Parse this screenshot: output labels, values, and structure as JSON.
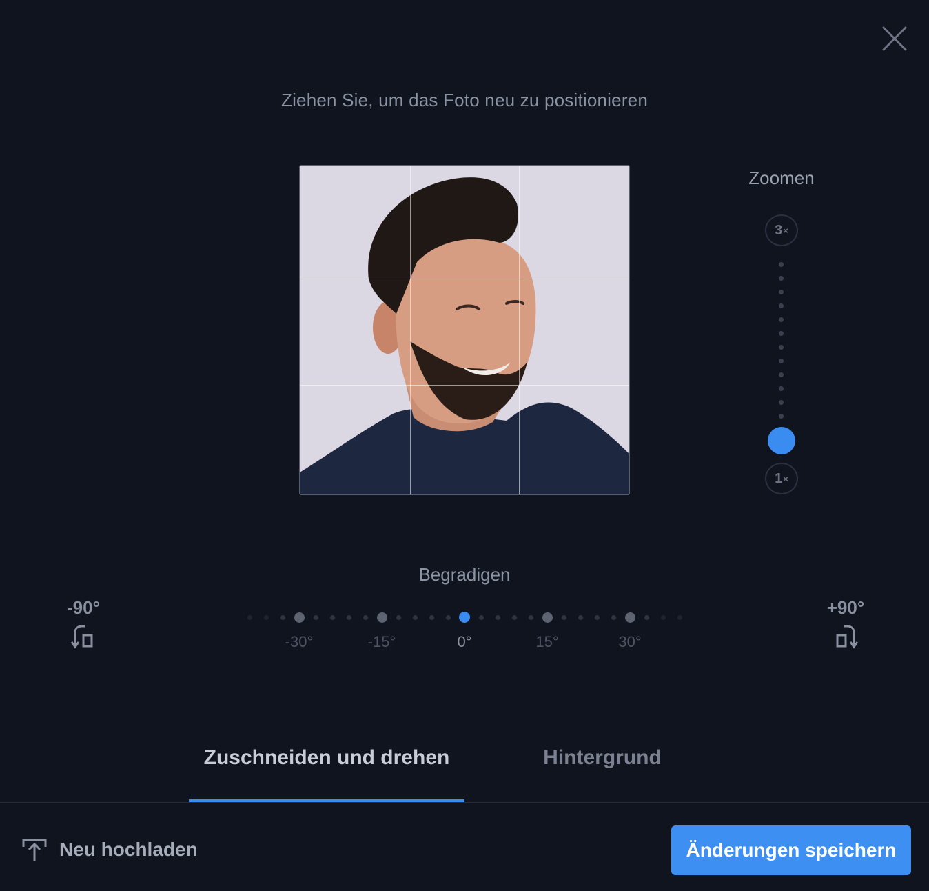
{
  "colors": {
    "background": "#10141f",
    "accent": "#3b8cf0",
    "text_primary": "#c7ccd6",
    "text_muted": "#8c93a3"
  },
  "dialog": {
    "close_icon": "close-icon",
    "instruction": "Ziehen Sie, um das Foto neu zu positionieren"
  },
  "zoom": {
    "label": "Zoomen",
    "max_label": "3",
    "min_label": "1",
    "unit": "×",
    "current_fraction": 0
  },
  "straighten": {
    "label": "Begradigen",
    "ticks": [
      "-30°",
      "-15°",
      "0°",
      "15°",
      "30°"
    ],
    "current": "0°",
    "rotate_left_label": "-90°",
    "rotate_right_label": "+90°",
    "rotate_left_icon": "rotate-left-icon",
    "rotate_right_icon": "rotate-right-icon"
  },
  "tabs": [
    {
      "label": "Zuschneiden und drehen",
      "active": true
    },
    {
      "label": "Hintergrund",
      "active": false
    }
  ],
  "footer": {
    "upload_label": "Neu hochladen",
    "upload_icon": "upload-icon",
    "save_label": "Änderungen speichern"
  }
}
